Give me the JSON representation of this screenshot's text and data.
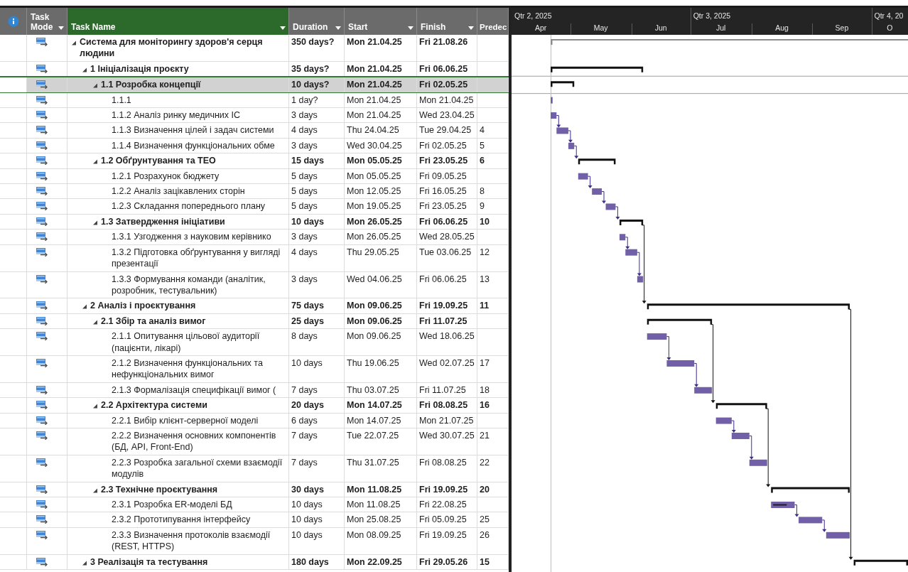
{
  "columns": [
    {
      "label": "Task Mode",
      "selected": false,
      "dropdown": true
    },
    {
      "label": "Task Name",
      "selected": true,
      "dropdown": true
    },
    {
      "label": "Duration",
      "selected": false,
      "dropdown": true
    },
    {
      "label": "Start",
      "selected": false,
      "dropdown": true
    },
    {
      "label": "Finish",
      "selected": false,
      "dropdown": true
    },
    {
      "label": "Predec",
      "selected": false,
      "dropdown": false
    }
  ],
  "timescale": {
    "quarters": [
      "Qtr 2, 2025",
      "Qtr 3, 2025",
      "Qtr 4, 20"
    ],
    "months": [
      "Apr",
      "May",
      "Jun",
      "Jul",
      "Aug",
      "Sep",
      "O"
    ]
  },
  "tasks": [
    {
      "kind": "project",
      "name": "Система для моніторингу здоров'я серця людини",
      "duration": "350 days?",
      "start": "Mon 21.04.25",
      "finish": "Fri 21.08.26",
      "expanded": true,
      "selected": false,
      "children": [
        {
          "kind": "summary",
          "name": "1 Ініціалізація проєкту",
          "duration": "35 days?",
          "start": "Mon 21.04.25",
          "finish": "Fri 06.06.25",
          "expanded": true,
          "selected": false,
          "children": [
            {
              "kind": "summary",
              "name": "1.1 Розробка концепції",
              "duration": "10 days?",
              "start": "Mon 21.04.25",
              "finish": "Fri 02.05.25",
              "expanded": true,
              "selected": true,
              "children": [
                {
                  "kind": "task",
                  "name": "1.1.1",
                  "duration": "1 day?",
                  "start": "Mon 21.04.25",
                  "finish": "Mon 21.04.25",
                  "selected": false
                },
                {
                  "kind": "task",
                  "name": "1.1.2 Аналіз ринку медичних ІС",
                  "duration": "3 days",
                  "start": "Mon 21.04.25",
                  "finish": "Wed 23.04.25",
                  "selected": false
                },
                {
                  "kind": "task",
                  "name": "1.1.3 Визначення цілей і задач системи",
                  "duration": "4 days",
                  "start": "Thu 24.04.25",
                  "finish": "Tue 29.04.25",
                  "predecessors": "4",
                  "selected": false
                },
                {
                  "kind": "task",
                  "name": "1.1.4 Визначення функціональних обме",
                  "duration": "3 days",
                  "start": "Wed 30.04.25",
                  "finish": "Fri 02.05.25",
                  "predecessors": "5",
                  "selected": false
                }
              ]
            },
            {
              "kind": "summary",
              "name": "1.2 Обґрунтування та ТЕО",
              "duration": "15 days",
              "start": "Mon 05.05.25",
              "finish": "Fri 23.05.25",
              "predecessors": "6",
              "expanded": true,
              "selected": false,
              "children": [
                {
                  "kind": "task",
                  "name": "1.2.1 Розрахунок бюджету",
                  "duration": "5 days",
                  "start": "Mon 05.05.25",
                  "finish": "Fri 09.05.25",
                  "selected": false
                },
                {
                  "kind": "task",
                  "name": "1.2.2 Аналіз зацікавлених сторін",
                  "duration": "5 days",
                  "start": "Mon 12.05.25",
                  "finish": "Fri 16.05.25",
                  "predecessors": "8",
                  "selected": false
                },
                {
                  "kind": "task",
                  "name": "1.2.3 Складання попереднього плану",
                  "duration": "5 days",
                  "start": "Mon 19.05.25",
                  "finish": "Fri 23.05.25",
                  "predecessors": "9",
                  "selected": false
                }
              ]
            },
            {
              "kind": "summary",
              "name": "1.3 Затвердження ініціативи",
              "duration": "10 days",
              "start": "Mon 26.05.25",
              "finish": "Fri 06.06.25",
              "predecessors": "10",
              "expanded": true,
              "selected": false,
              "children": [
                {
                  "kind": "task",
                  "name": "1.3.1 Узгодження з науковим керівнико",
                  "duration": "3 days",
                  "start": "Mon 26.05.25",
                  "finish": "Wed 28.05.25",
                  "selected": false
                },
                {
                  "kind": "task",
                  "name": "1.3.2 Підготовка обґрунтування у вигляді презентації",
                  "duration": "4 days",
                  "start": "Thu 29.05.25",
                  "finish": "Tue 03.06.25",
                  "predecessors": "12",
                  "selected": false
                },
                {
                  "kind": "task",
                  "name": "1.3.3 Формування команди (аналітик, розробник, тестувальник)",
                  "duration": "3 days",
                  "start": "Wed 04.06.25",
                  "finish": "Fri 06.06.25",
                  "predecessors": "13",
                  "selected": false
                }
              ]
            }
          ]
        },
        {
          "kind": "summary",
          "name": "2 Аналіз і проєктування",
          "duration": "75 days",
          "start": "Mon 09.06.25",
          "finish": "Fri 19.09.25",
          "predecessors": "11",
          "expanded": true,
          "selected": false,
          "children": [
            {
              "kind": "summary",
              "name": "2.1 Збір та аналіз вимог",
              "duration": "25 days",
              "start": "Mon 09.06.25",
              "finish": "Fri 11.07.25",
              "expanded": true,
              "selected": false,
              "children": [
                {
                  "kind": "task",
                  "name": "2.1.1 Опитування цільової аудиторії (пацієнти, лікарі)",
                  "duration": "8 days",
                  "start": "Mon 09.06.25",
                  "finish": "Wed 18.06.25",
                  "selected": false
                },
                {
                  "kind": "task",
                  "name": "2.1.2 Визначення функціональних та нефункціональних вимог",
                  "duration": "10 days",
                  "start": "Thu 19.06.25",
                  "finish": "Wed 02.07.25",
                  "predecessors": "17",
                  "selected": false
                },
                {
                  "kind": "task",
                  "name": "2.1.3 Формалізація специфікації вимог (",
                  "duration": "7 days",
                  "start": "Thu 03.07.25",
                  "finish": "Fri 11.07.25",
                  "predecessors": "18",
                  "selected": false
                }
              ]
            },
            {
              "kind": "summary",
              "name": "2.2 Архітектура системи",
              "duration": "20 days",
              "start": "Mon 14.07.25",
              "finish": "Fri 08.08.25",
              "predecessors": "16",
              "expanded": true,
              "selected": false,
              "children": [
                {
                  "kind": "task",
                  "name": "2.2.1 Вибір клієнт-серверної моделі",
                  "duration": "6 days",
                  "start": "Mon 14.07.25",
                  "finish": "Mon 21.07.25",
                  "selected": false
                },
                {
                  "kind": "task",
                  "name": "2.2.2 Визначення основних компонентів (БД, API, Front-End)",
                  "duration": "7 days",
                  "start": "Tue 22.07.25",
                  "finish": "Wed 30.07.25",
                  "predecessors": "21",
                  "selected": false
                },
                {
                  "kind": "task",
                  "name": "2.2.3 Розробка загальної схеми взаємодії модулів",
                  "duration": "7 days",
                  "start": "Thu 31.07.25",
                  "finish": "Fri 08.08.25",
                  "predecessors": "22",
                  "selected": false
                }
              ]
            },
            {
              "kind": "summary",
              "name": "2.3 Технічне проєктування",
              "duration": "30 days",
              "start": "Mon 11.08.25",
              "finish": "Fri 19.09.25",
              "predecessors": "20",
              "expanded": true,
              "selected": false,
              "children": [
                {
                  "kind": "task",
                  "name": "2.3.1 Розробка ER-моделі БД",
                  "duration": "10 days",
                  "start": "Mon 11.08.25",
                  "finish": "Fri 22.08.25",
                  "level": 0.7,
                  "selected": false
                },
                {
                  "kind": "task",
                  "name": "2.3.2 Прототипування інтерфейсу",
                  "duration": "10 days",
                  "start": "Mon 25.08.25",
                  "finish": "Fri 05.09.25",
                  "predecessors": "25",
                  "selected": false
                },
                {
                  "kind": "task",
                  "name": "2.3.3 Визначення протоколів взаємодії (REST, HTTPS)",
                  "duration": "10 days",
                  "start": "Mon 08.09.25",
                  "finish": "Fri 19.09.25",
                  "predecessors": "26",
                  "selected": false
                }
              ]
            }
          ]
        },
        {
          "kind": "summary",
          "name": "3 Реалізація та тестування",
          "duration": "180 days",
          "start": "Mon 22.09.25",
          "finish": "Fri 29.05.26",
          "predecessors": "15",
          "expanded": true,
          "selected": false
        }
      ]
    }
  ]
}
